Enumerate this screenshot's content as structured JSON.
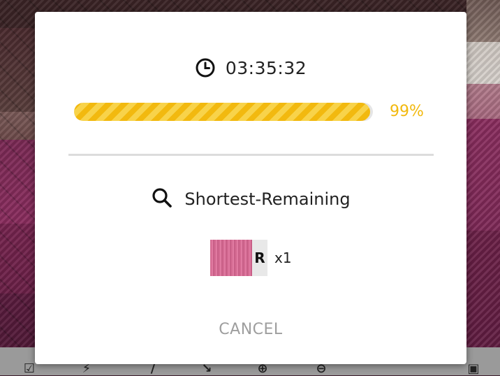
{
  "timer": {
    "value": "03:35:32",
    "icon": "clock-icon"
  },
  "progress": {
    "percent": 99,
    "label": "99%",
    "color": "#f2b90f"
  },
  "sort": {
    "label": "Shortest-Remaining",
    "icon": "search-icon"
  },
  "thread": {
    "symbol": "R",
    "count": "x1",
    "color": "#d9709a"
  },
  "actions": {
    "cancel_label": "CANCEL"
  },
  "toolbar": {
    "icons": [
      "checkbox-icon",
      "bolt-icon",
      "needle-icon",
      "needle-icon",
      "zoom-in-icon",
      "zoom-out-icon",
      "frame-icon"
    ]
  }
}
